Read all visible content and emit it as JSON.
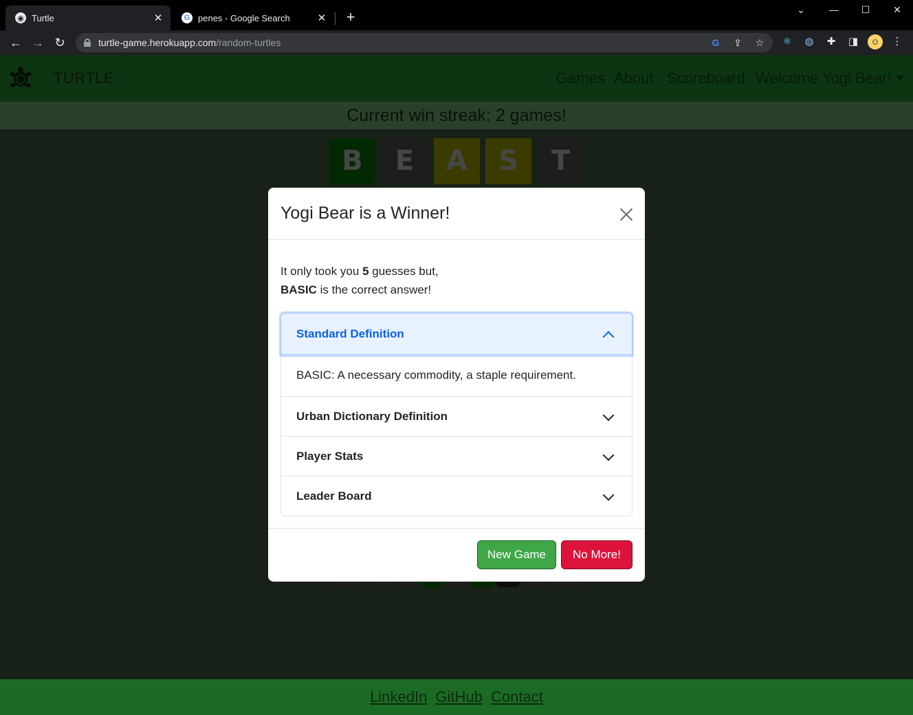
{
  "browser": {
    "tabs": [
      {
        "title": "Turtle",
        "active": true
      },
      {
        "title": "penes - Google Search",
        "active": false
      }
    ],
    "new_tab": "+",
    "url_host": "turtle-game.herokuapp.com",
    "url_path": "/random-turtles",
    "window_controls": {
      "dropdown": "⌄",
      "minimize": "—",
      "maximize": "☐",
      "close": "✕"
    }
  },
  "nav": {
    "brand": "TURTLE",
    "links": [
      "Games",
      "About",
      "Scoreboard"
    ],
    "user_menu": "Welcome Yogi Bear!"
  },
  "streak_text": "Current win streak: 2 games!",
  "board": {
    "tiles": [
      {
        "letter": "B",
        "color": "#075207"
      },
      {
        "letter": "E",
        "color": "#3a3a3a"
      },
      {
        "letter": "A",
        "color": "#767600"
      },
      {
        "letter": "S",
        "color": "#767600"
      },
      {
        "letter": "T",
        "color": "#3a3a3a"
      }
    ]
  },
  "modal": {
    "title": "Yogi Bear is a Winner!",
    "msg_prefix": "It only took you ",
    "guesses": "5",
    "msg_suffix": " guesses but,",
    "answer": "BASIC",
    "answer_suffix": " is the correct answer!",
    "accordion": [
      {
        "label": "Standard Definition",
        "open": true,
        "content": "BASIC: A necessary commodity, a staple requirement."
      },
      {
        "label": "Urban Dictionary Definition",
        "open": false
      },
      {
        "label": "Player Stats",
        "open": false
      },
      {
        "label": "Leader Board",
        "open": false
      }
    ],
    "buttons": {
      "new_game": "New Game",
      "no_more": "No More!"
    }
  },
  "footer": {
    "links": [
      "LinkedIn",
      "GitHub",
      "Contact"
    ]
  },
  "colors": {
    "navbar": "#1c6b24",
    "streak_bar": "#528354",
    "page_bg": "#2f432f",
    "new_game_btn": "#3fa747",
    "no_more_btn": "#dc143c",
    "accordion_active": "#0c63e4"
  }
}
